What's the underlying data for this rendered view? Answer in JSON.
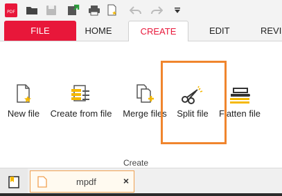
{
  "quick_access": {
    "icons": [
      "pdf-logo-icon",
      "open-folder-icon",
      "save-icon",
      "export-icon",
      "print-icon",
      "new-document-icon",
      "undo-icon",
      "redo-icon",
      "customize-dropdown-icon"
    ]
  },
  "tabs": [
    {
      "label": "FILE"
    },
    {
      "label": "HOME"
    },
    {
      "label": "CREATE"
    },
    {
      "label": "EDIT"
    },
    {
      "label": "REVIEW"
    }
  ],
  "active_tab": "CREATE",
  "ribbon": {
    "buttons": [
      {
        "label": "New file",
        "icon": "new-file-icon"
      },
      {
        "label": "Create from file",
        "icon": "create-from-file-icon"
      },
      {
        "label": "Merge files",
        "icon": "merge-files-icon"
      },
      {
        "label": "Split file",
        "icon": "scissors-icon"
      },
      {
        "label": "Flatten file",
        "icon": "flatten-file-icon"
      }
    ],
    "group_label": "Create"
  },
  "document_tabs": [
    {
      "name": "mpdf",
      "close": "×"
    }
  ],
  "colors": {
    "brand_red": "#e8173a",
    "highlight_orange": "#f0852d",
    "accent_yellow": "#f5b800"
  }
}
